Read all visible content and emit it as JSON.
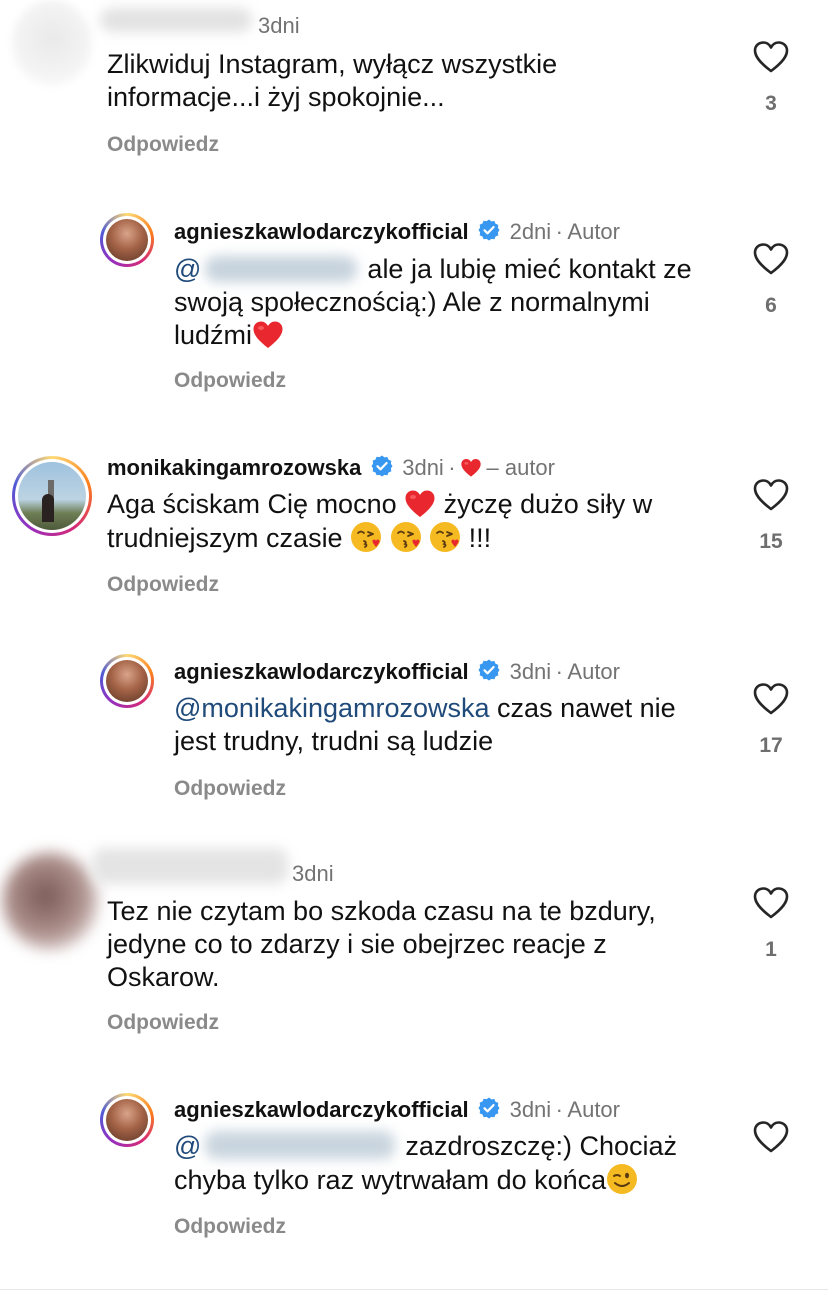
{
  "comments": [
    {
      "id": "c1",
      "time": "3dni",
      "text_lines": [
        "Zlikwiduj Instagram, wyłącz wszystkie",
        "informacje...i żyj spokojnie..."
      ],
      "likes": "3",
      "reply_label": "Odpowiedz"
    },
    {
      "id": "r1",
      "username": "agnieszkawlodarczykofficial",
      "time": "2dni",
      "author_tag": "Autor",
      "mention": "@",
      "text_lines": [
        "ale ja lubię mieć kontakt ze",
        "swoją społecznością:) Ale z normalnymi",
        "ludźmi"
      ],
      "likes": "6",
      "reply_label": "Odpowiedz"
    },
    {
      "id": "c2",
      "username": "monikakingamrozowska",
      "time": "3dni",
      "liked_by_author": "– autor",
      "text_lines": [
        "Aga ściskam Cię mocno",
        "życzę dużo siły w",
        "trudniejszym czasie",
        "!!!"
      ],
      "likes": "15",
      "reply_label": "Odpowiedz"
    },
    {
      "id": "r2",
      "username": "agnieszkawlodarczykofficial",
      "time": "3dni",
      "author_tag": "Autor",
      "mention": "@monikakingamrozowska",
      "text_lines": [
        "czas nawet nie",
        "jest trudny, trudni są ludzie"
      ],
      "likes": "17",
      "reply_label": "Odpowiedz"
    },
    {
      "id": "c3",
      "time": "3dni",
      "text_lines": [
        "Tez nie czytam bo szkoda czasu na te bzdury,",
        "jedyne co to zdarzy i sie obejrzec reacje z",
        "Oskarow."
      ],
      "likes": "1",
      "reply_label": "Odpowiedz"
    },
    {
      "id": "r3",
      "username": "agnieszkawlodarczykofficial",
      "time": "3dni",
      "author_tag": "Autor",
      "mention": "@",
      "text_lines": [
        "zazdroszczę:) Chociaż",
        "chyba tylko raz wytrwałam do końca"
      ],
      "reply_label": "Odpowiedz"
    }
  ],
  "separator": "·",
  "icons": {
    "like": "heart-outline-icon",
    "verified": "verified-badge-icon",
    "heart_emoji": "red-heart-emoji",
    "kiss_emoji": "face-blowing-kiss-emoji",
    "wink_emoji": "winking-face-emoji"
  },
  "colors": {
    "verified": "#3897f0",
    "heart": "#e0245e",
    "mention": "#1f4a7a",
    "meta": "#737373"
  }
}
